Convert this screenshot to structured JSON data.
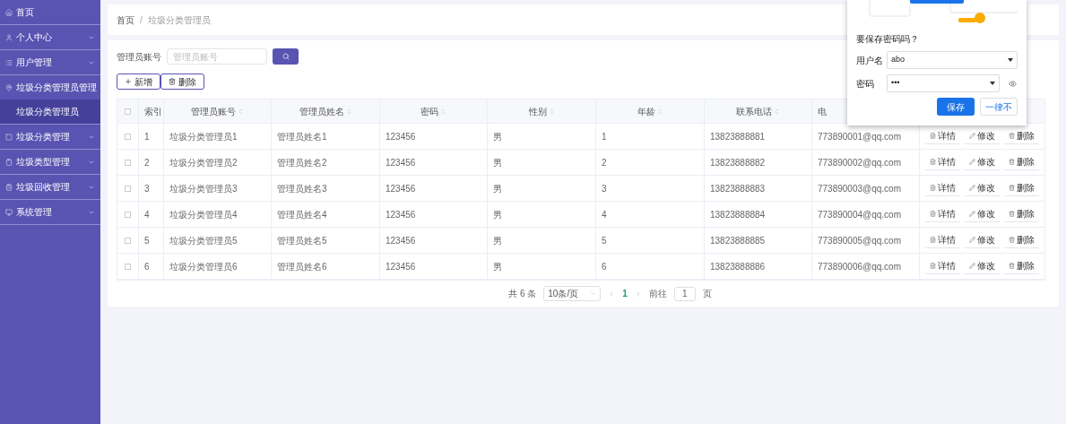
{
  "sidebar": {
    "items": [
      {
        "kind": "link",
        "label": "首页"
      },
      {
        "kind": "menu",
        "label": "个人中心",
        "expanded": false
      },
      {
        "kind": "menu",
        "label": "用户管理",
        "expanded": false
      },
      {
        "kind": "menu",
        "label": "垃圾分类管理员管理",
        "expanded": true,
        "children": [
          {
            "label": "垃圾分类管理员",
            "selected": true
          }
        ]
      },
      {
        "kind": "menu",
        "label": "垃圾分类管理",
        "expanded": false
      },
      {
        "kind": "menu",
        "label": "垃圾类型管理",
        "expanded": false
      },
      {
        "kind": "menu",
        "label": "垃圾回收管理",
        "expanded": false
      },
      {
        "kind": "menu",
        "label": "系统管理",
        "expanded": false
      }
    ]
  },
  "breadcrumb": {
    "items": [
      "首页",
      "垃圾分类管理员"
    ],
    "separator": "/"
  },
  "search": {
    "label": "管理员账号",
    "placeholder": "管理员账号"
  },
  "toolbar": [
    "新增",
    "删除"
  ],
  "table": {
    "all_selected": false,
    "columns": [
      "索引",
      "管理员账号",
      "管理员姓名",
      "密码",
      "性别",
      "年龄",
      "联系电话",
      "电"
    ],
    "rows": [
      {
        "selected": false,
        "cells": [
          "1",
          "垃圾分类管理员1",
          "管理员姓名1",
          "123456",
          "男",
          "1",
          "13823888881",
          "773890001@qq.com"
        ],
        "actions": [
          "详情",
          "修改",
          "删除"
        ]
      },
      {
        "selected": false,
        "cells": [
          "2",
          "垃圾分类管理员2",
          "管理员姓名2",
          "123456",
          "男",
          "2",
          "13823888882",
          "773890002@qq.com"
        ],
        "actions": [
          "详情",
          "修改",
          "删除"
        ]
      },
      {
        "selected": false,
        "cells": [
          "3",
          "垃圾分类管理员3",
          "管理员姓名3",
          "123456",
          "男",
          "3",
          "13823888883",
          "773890003@qq.com"
        ],
        "actions": [
          "详情",
          "修改",
          "删除"
        ]
      },
      {
        "selected": false,
        "cells": [
          "4",
          "垃圾分类管理员4",
          "管理员姓名4",
          "123456",
          "男",
          "4",
          "13823888884",
          "773890004@qq.com"
        ],
        "actions": [
          "详情",
          "修改",
          "删除"
        ]
      },
      {
        "selected": false,
        "cells": [
          "5",
          "垃圾分类管理员5",
          "管理员姓名5",
          "123456",
          "男",
          "5",
          "13823888885",
          "773890005@qq.com"
        ],
        "actions": [
          "详情",
          "修改",
          "删除"
        ]
      },
      {
        "selected": false,
        "cells": [
          "6",
          "垃圾分类管理员6",
          "管理员姓名6",
          "123456",
          "男",
          "6",
          "13823888886",
          "773890006@qq.com"
        ],
        "actions": [
          "详情",
          "修改",
          "删除"
        ]
      }
    ]
  },
  "pagination": {
    "total": "共 6 条",
    "page_size": "10条/页",
    "pages": [
      {
        "label": "1",
        "selected": true
      }
    ],
    "goto_label": "前往",
    "goto_value": "1",
    "goto_suffix": "页"
  },
  "save_password_popup": {
    "title": "要保存密码吗？",
    "username_label": "用户名",
    "username": "abo",
    "password_label": "密码",
    "password": "•••",
    "buttons": [
      {
        "label": "保存",
        "kind": "primary"
      },
      {
        "label": "一律不",
        "kind": "secondary"
      }
    ]
  }
}
